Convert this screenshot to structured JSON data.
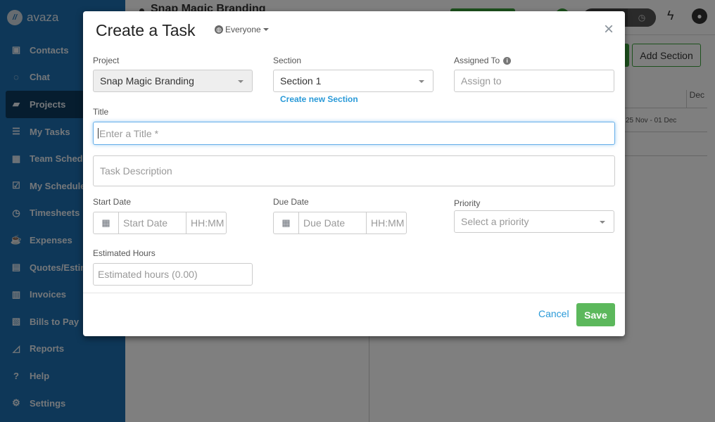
{
  "app": {
    "brand": "avaza",
    "logo_mark": "//",
    "project_title": "Snap Magic Branding"
  },
  "sidebar": {
    "items": [
      {
        "label": "Contacts",
        "icon": "contacts-icon",
        "glyph": "▣"
      },
      {
        "label": "Chat",
        "icon": "chat-icon",
        "glyph": "◌"
      },
      {
        "label": "Projects",
        "icon": "folder-icon",
        "glyph": "▰",
        "active": true
      },
      {
        "label": "My Tasks",
        "icon": "tasks-icon",
        "glyph": "☰"
      },
      {
        "label": "Team Schedule",
        "icon": "calendar-icon",
        "glyph": "▦"
      },
      {
        "label": "My Schedule",
        "icon": "calendar-check-icon",
        "glyph": "☑"
      },
      {
        "label": "Timesheets",
        "icon": "stopwatch-icon",
        "glyph": "◷"
      },
      {
        "label": "Expenses",
        "icon": "cup-icon",
        "glyph": "☕"
      },
      {
        "label": "Quotes/Estimates",
        "icon": "calculator-icon",
        "glyph": "▤"
      },
      {
        "label": "Invoices",
        "icon": "invoice-icon",
        "glyph": "▥"
      },
      {
        "label": "Bills to Pay",
        "icon": "bill-icon",
        "glyph": "▧"
      },
      {
        "label": "Reports",
        "icon": "chart-icon",
        "glyph": "◿"
      },
      {
        "label": "Help",
        "icon": "help-icon",
        "glyph": "?"
      },
      {
        "label": "Settings",
        "icon": "gear-icon",
        "glyph": "⚙"
      }
    ]
  },
  "background": {
    "add_section_label": "Add Section",
    "grid_header": "Dec",
    "grid_row": "25 Nov - 01 Dec"
  },
  "modal": {
    "title": "Create a Task",
    "visibility": "Everyone",
    "close_glyph": "×",
    "project": {
      "label": "Project",
      "value": "Snap Magic Branding"
    },
    "section": {
      "label": "Section",
      "value": "Section 1",
      "create_link": "Create new Section"
    },
    "assigned": {
      "label": "Assigned To",
      "placeholder": "Assign to"
    },
    "title_field": {
      "label": "Title",
      "placeholder": "Enter a Title *"
    },
    "description": {
      "placeholder": "Task Description"
    },
    "start_date": {
      "label": "Start Date",
      "date_placeholder": "Start Date",
      "time_placeholder": "HH:MM"
    },
    "due_date": {
      "label": "Due Date",
      "date_placeholder": "Due Date",
      "time_placeholder": "HH:MM"
    },
    "priority": {
      "label": "Priority",
      "placeholder": "Select a priority"
    },
    "estimated": {
      "label": "Estimated Hours",
      "placeholder": "Estimated hours (0.00)"
    },
    "cancel_label": "Cancel",
    "save_label": "Save"
  }
}
